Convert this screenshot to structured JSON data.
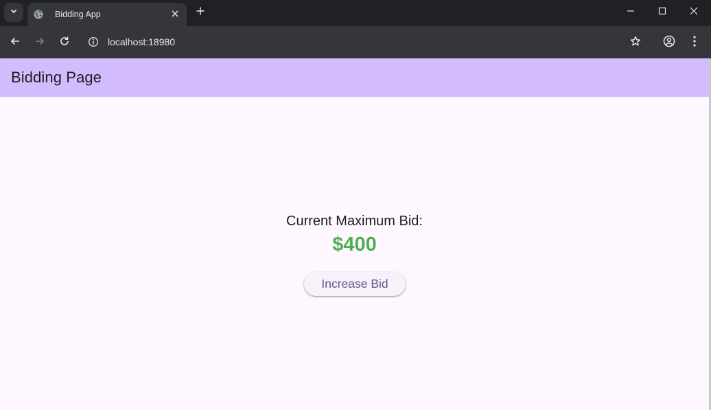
{
  "browser": {
    "tab_title": "Bidding App",
    "address": "localhost:18980",
    "icons": {
      "tab_search": "chevron-down-icon",
      "favicon": "globe-icon",
      "tab_close": "close-icon",
      "new_tab": "plus-icon",
      "minimize": "minimize-icon",
      "maximize": "maximize-icon",
      "close_window": "close-icon",
      "back": "back-arrow-icon",
      "forward": "forward-arrow-icon",
      "reload": "reload-icon",
      "site_info": "info-icon",
      "bookmark": "star-icon",
      "profile": "profile-icon",
      "menu": "more-vert-icon"
    }
  },
  "app": {
    "title": "Bidding Page",
    "bid_label": "Current Maximum Bid:",
    "bid_value": "$400",
    "increase_button": "Increase Bid"
  },
  "colors": {
    "appbar": "#d3bcfd",
    "background": "#fef7ff",
    "bid_value": "#4caf50",
    "button_text": "#65558f"
  }
}
